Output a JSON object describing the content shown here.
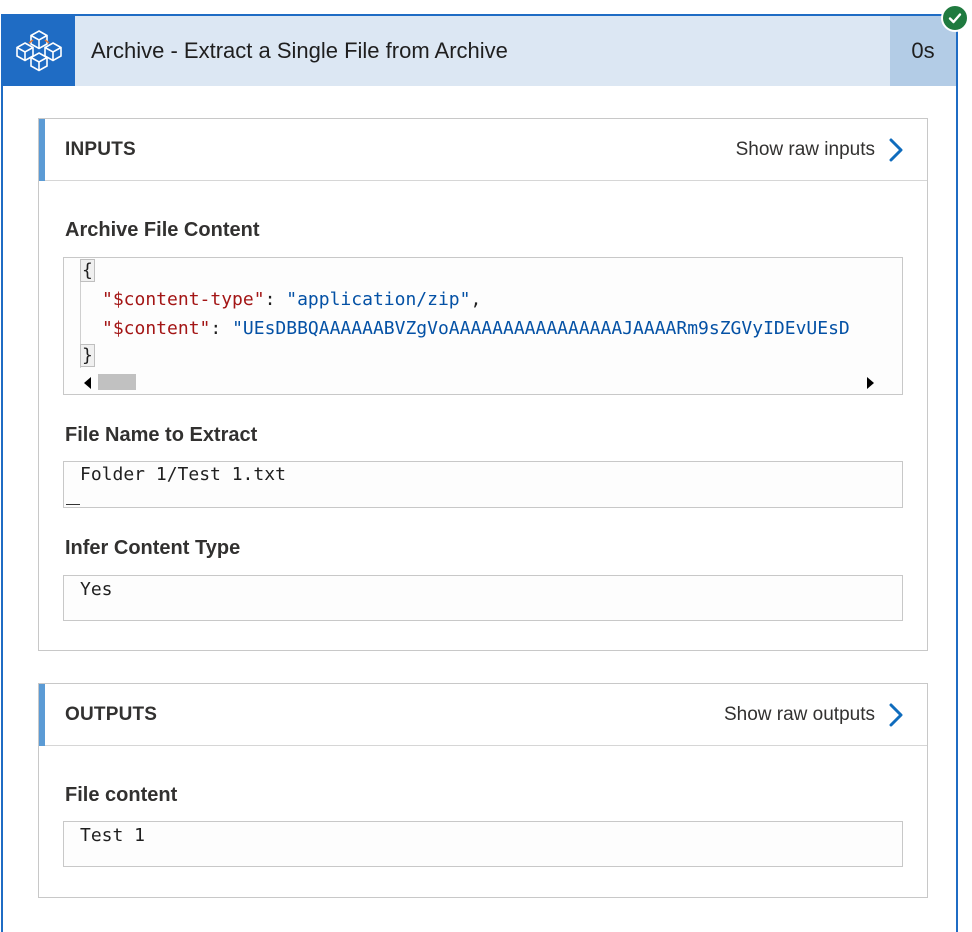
{
  "header": {
    "title": "Archive - Extract a Single File from Archive",
    "duration": "0s",
    "icon": "archive-cubes-icon",
    "status": "succeeded-check-icon",
    "colors": {
      "accent": "#1f6cc4",
      "header_bg": "#dce7f3",
      "duration_bg": "#b3cce6",
      "success": "#1f7a3f"
    }
  },
  "inputs": {
    "title": "INPUTS",
    "raw_link": "Show raw inputs",
    "archive_file_content": {
      "label": "Archive File Content",
      "open_brace": "{",
      "line1_key": "\"$content-type\"",
      "line1_colon": ": ",
      "line1_value": "\"application/zip\"",
      "line1_comma": ",",
      "line2_key": "\"$content\"",
      "line2_colon": ": ",
      "line2_value": "\"UEsDBBQAAAAAABVZgVoAAAAAAAAAAAAAAAAJAAAARm9sZGVyIDEvUEsD",
      "close_brace": "}"
    },
    "file_name": {
      "label": "File Name to Extract",
      "value": "Folder 1/Test 1.txt"
    },
    "infer_content_type": {
      "label": "Infer Content Type",
      "value": "Yes"
    }
  },
  "outputs": {
    "title": "OUTPUTS",
    "raw_link": "Show raw outputs",
    "file_content": {
      "label": "File content",
      "value": "Test 1"
    }
  }
}
